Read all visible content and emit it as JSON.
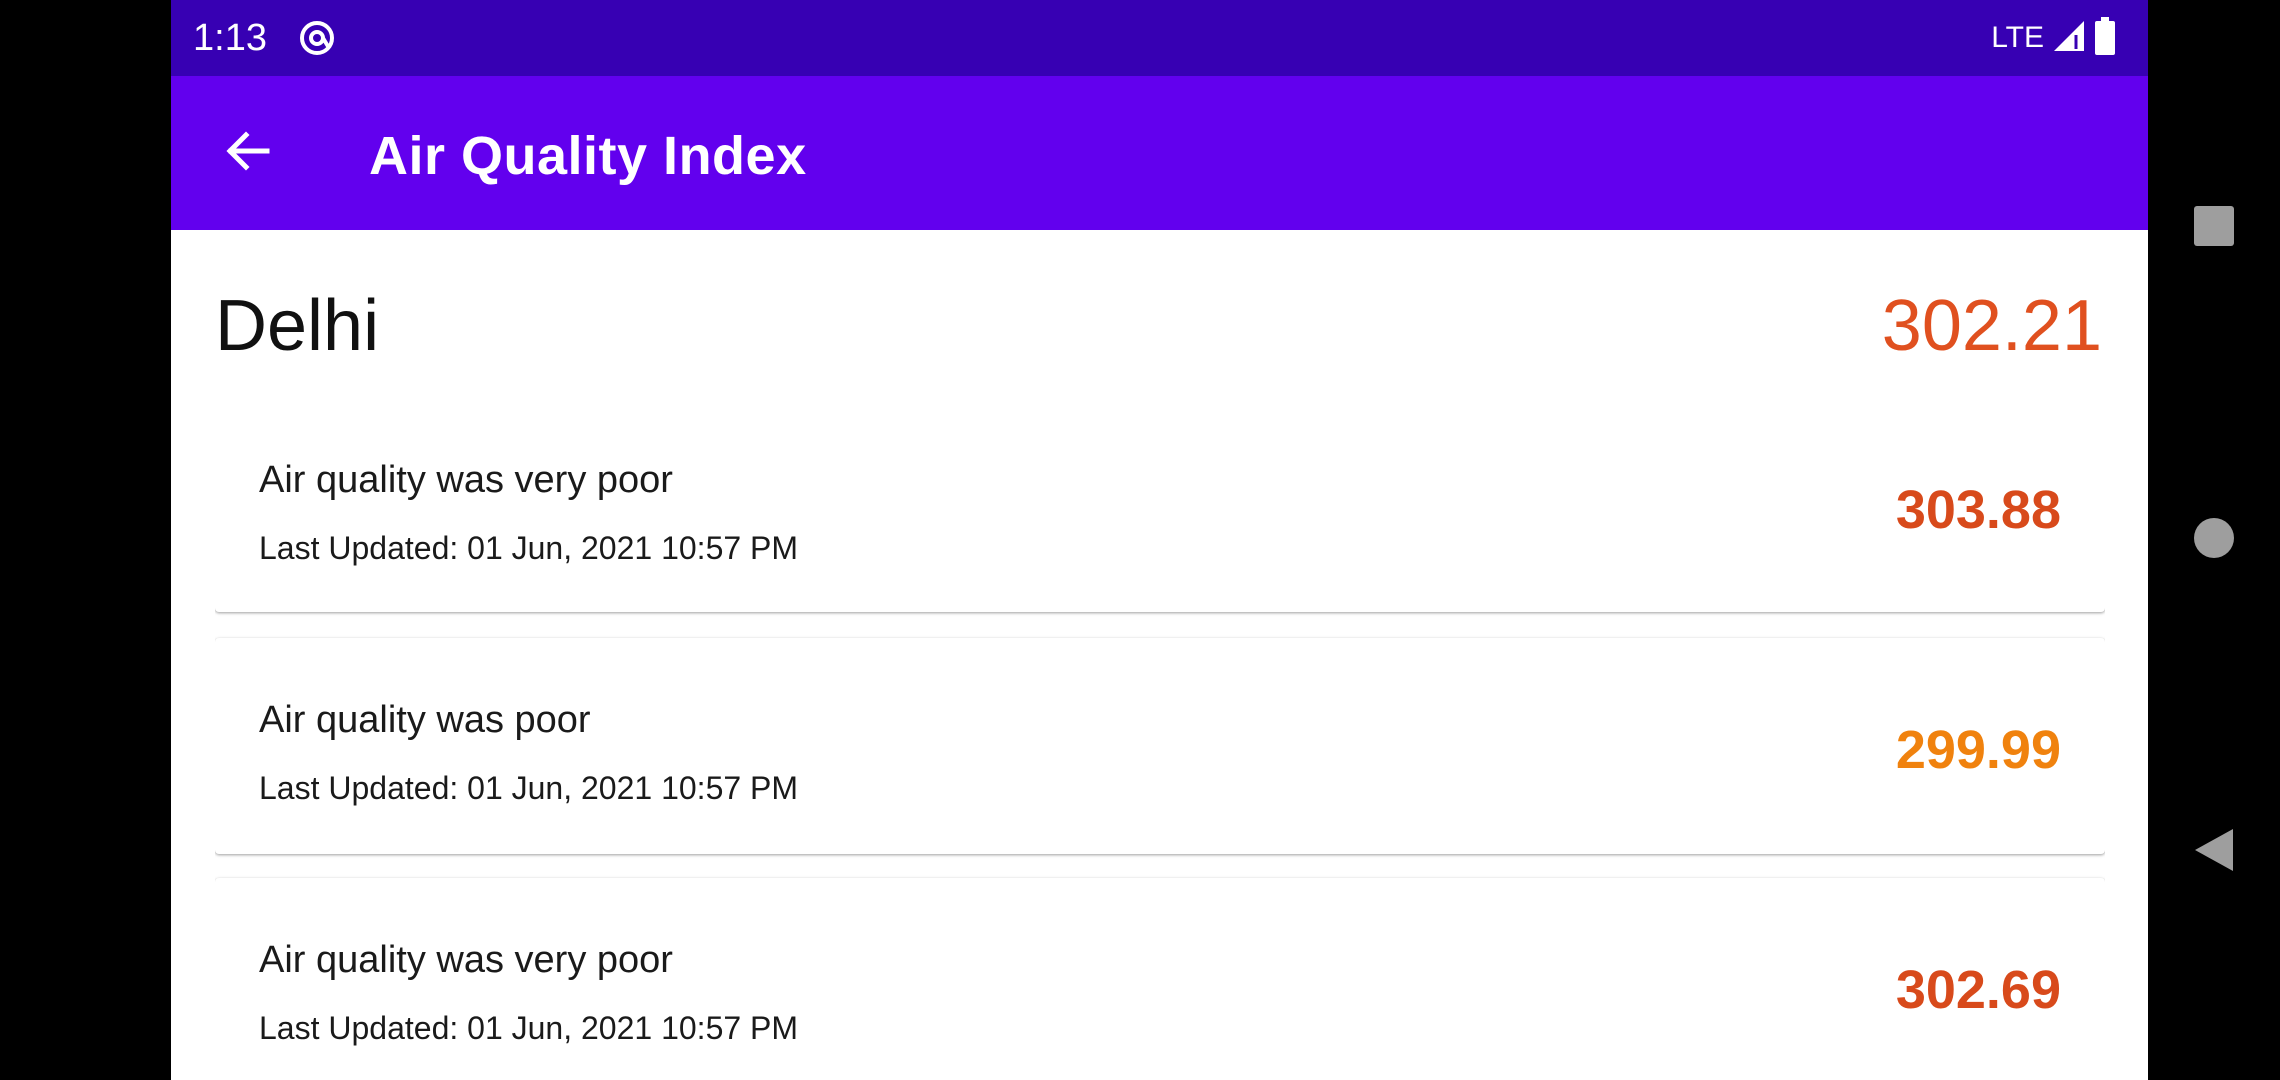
{
  "status_bar": {
    "time": "1:13",
    "network": "LTE",
    "app_icon": "at-sign-icon",
    "signal_icon": "signal-icon",
    "battery_icon": "battery-icon",
    "bg_color": "#3700b3"
  },
  "app_bar": {
    "title": "Air Quality Index",
    "back_icon": "arrow-back-icon",
    "bg_color": "#6200ee"
  },
  "city": {
    "name": "Delhi",
    "aqi": "302.21",
    "aqi_color": "#e0501f"
  },
  "readings": [
    {
      "status": "Air quality was very poor",
      "updated": "Last Updated: 01 Jun, 2021 10:57 PM",
      "value": "303.88",
      "color": "#d84a1b"
    },
    {
      "status": "Air quality was poor",
      "updated": "Last Updated: 01 Jun, 2021 10:57 PM",
      "value": "299.99",
      "color": "#f0820e"
    },
    {
      "status": "Air quality was very poor",
      "updated": "Last Updated: 01 Jun, 2021 10:57 PM",
      "value": "302.69",
      "color": "#d84a1b"
    }
  ],
  "nav_bar": {
    "recents_icon": "square-icon",
    "home_icon": "circle-icon",
    "back_icon": "triangle-back-icon"
  }
}
